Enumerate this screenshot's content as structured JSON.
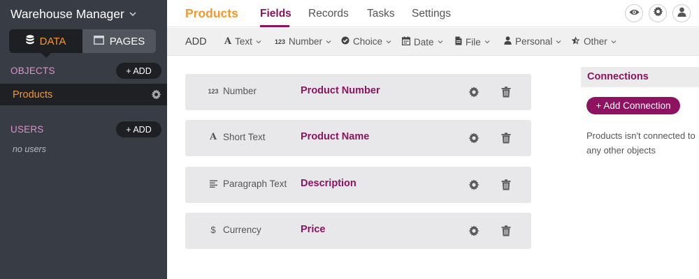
{
  "app": {
    "title": "Warehouse Manager"
  },
  "sidebar": {
    "toggle": {
      "data_label": "DATA",
      "pages_label": "PAGES"
    },
    "objects": {
      "label": "OBJECTS",
      "add_label": "+ ADD",
      "items": [
        {
          "label": "Products"
        }
      ]
    },
    "users": {
      "label": "USERS",
      "add_label": "+ ADD",
      "empty_text": "no users"
    }
  },
  "topnav": {
    "breadcrumb": "Products",
    "tabs": [
      {
        "label": "Fields",
        "active": true
      },
      {
        "label": "Records"
      },
      {
        "label": "Tasks"
      },
      {
        "label": "Settings"
      }
    ],
    "icons": [
      "eye-icon",
      "gear-icon",
      "user-icon"
    ]
  },
  "toolbar": {
    "add_label": "ADD",
    "types": [
      {
        "label": "Text",
        "icon": "A"
      },
      {
        "label": "Number",
        "icon": "123"
      },
      {
        "label": "Choice",
        "icon": "check-circle-icon"
      },
      {
        "label": "Date",
        "icon": "calendar-icon"
      },
      {
        "label": "File",
        "icon": "file-icon"
      },
      {
        "label": "Personal",
        "icon": "person-icon"
      },
      {
        "label": "Other",
        "icon": "star-icon"
      }
    ]
  },
  "fields": [
    {
      "type": "Number",
      "type_icon": "123",
      "name": "Product Number"
    },
    {
      "type": "Short Text",
      "type_icon": "A",
      "name": "Product Name"
    },
    {
      "type": "Paragraph Text",
      "type_icon": "paragraph-icon",
      "name": "Description"
    },
    {
      "type": "Currency",
      "type_icon": "$",
      "name": "Price"
    }
  ],
  "connections": {
    "title": "Connections",
    "add_label": "+ Add Connection",
    "empty_text": "Products isn't connected to any other objects"
  },
  "colors": {
    "sidebar_bg": "#383c44",
    "accent_orange": "#f3982d",
    "accent_purple": "#8e1260",
    "sidebar_pink": "#e48fd0"
  }
}
